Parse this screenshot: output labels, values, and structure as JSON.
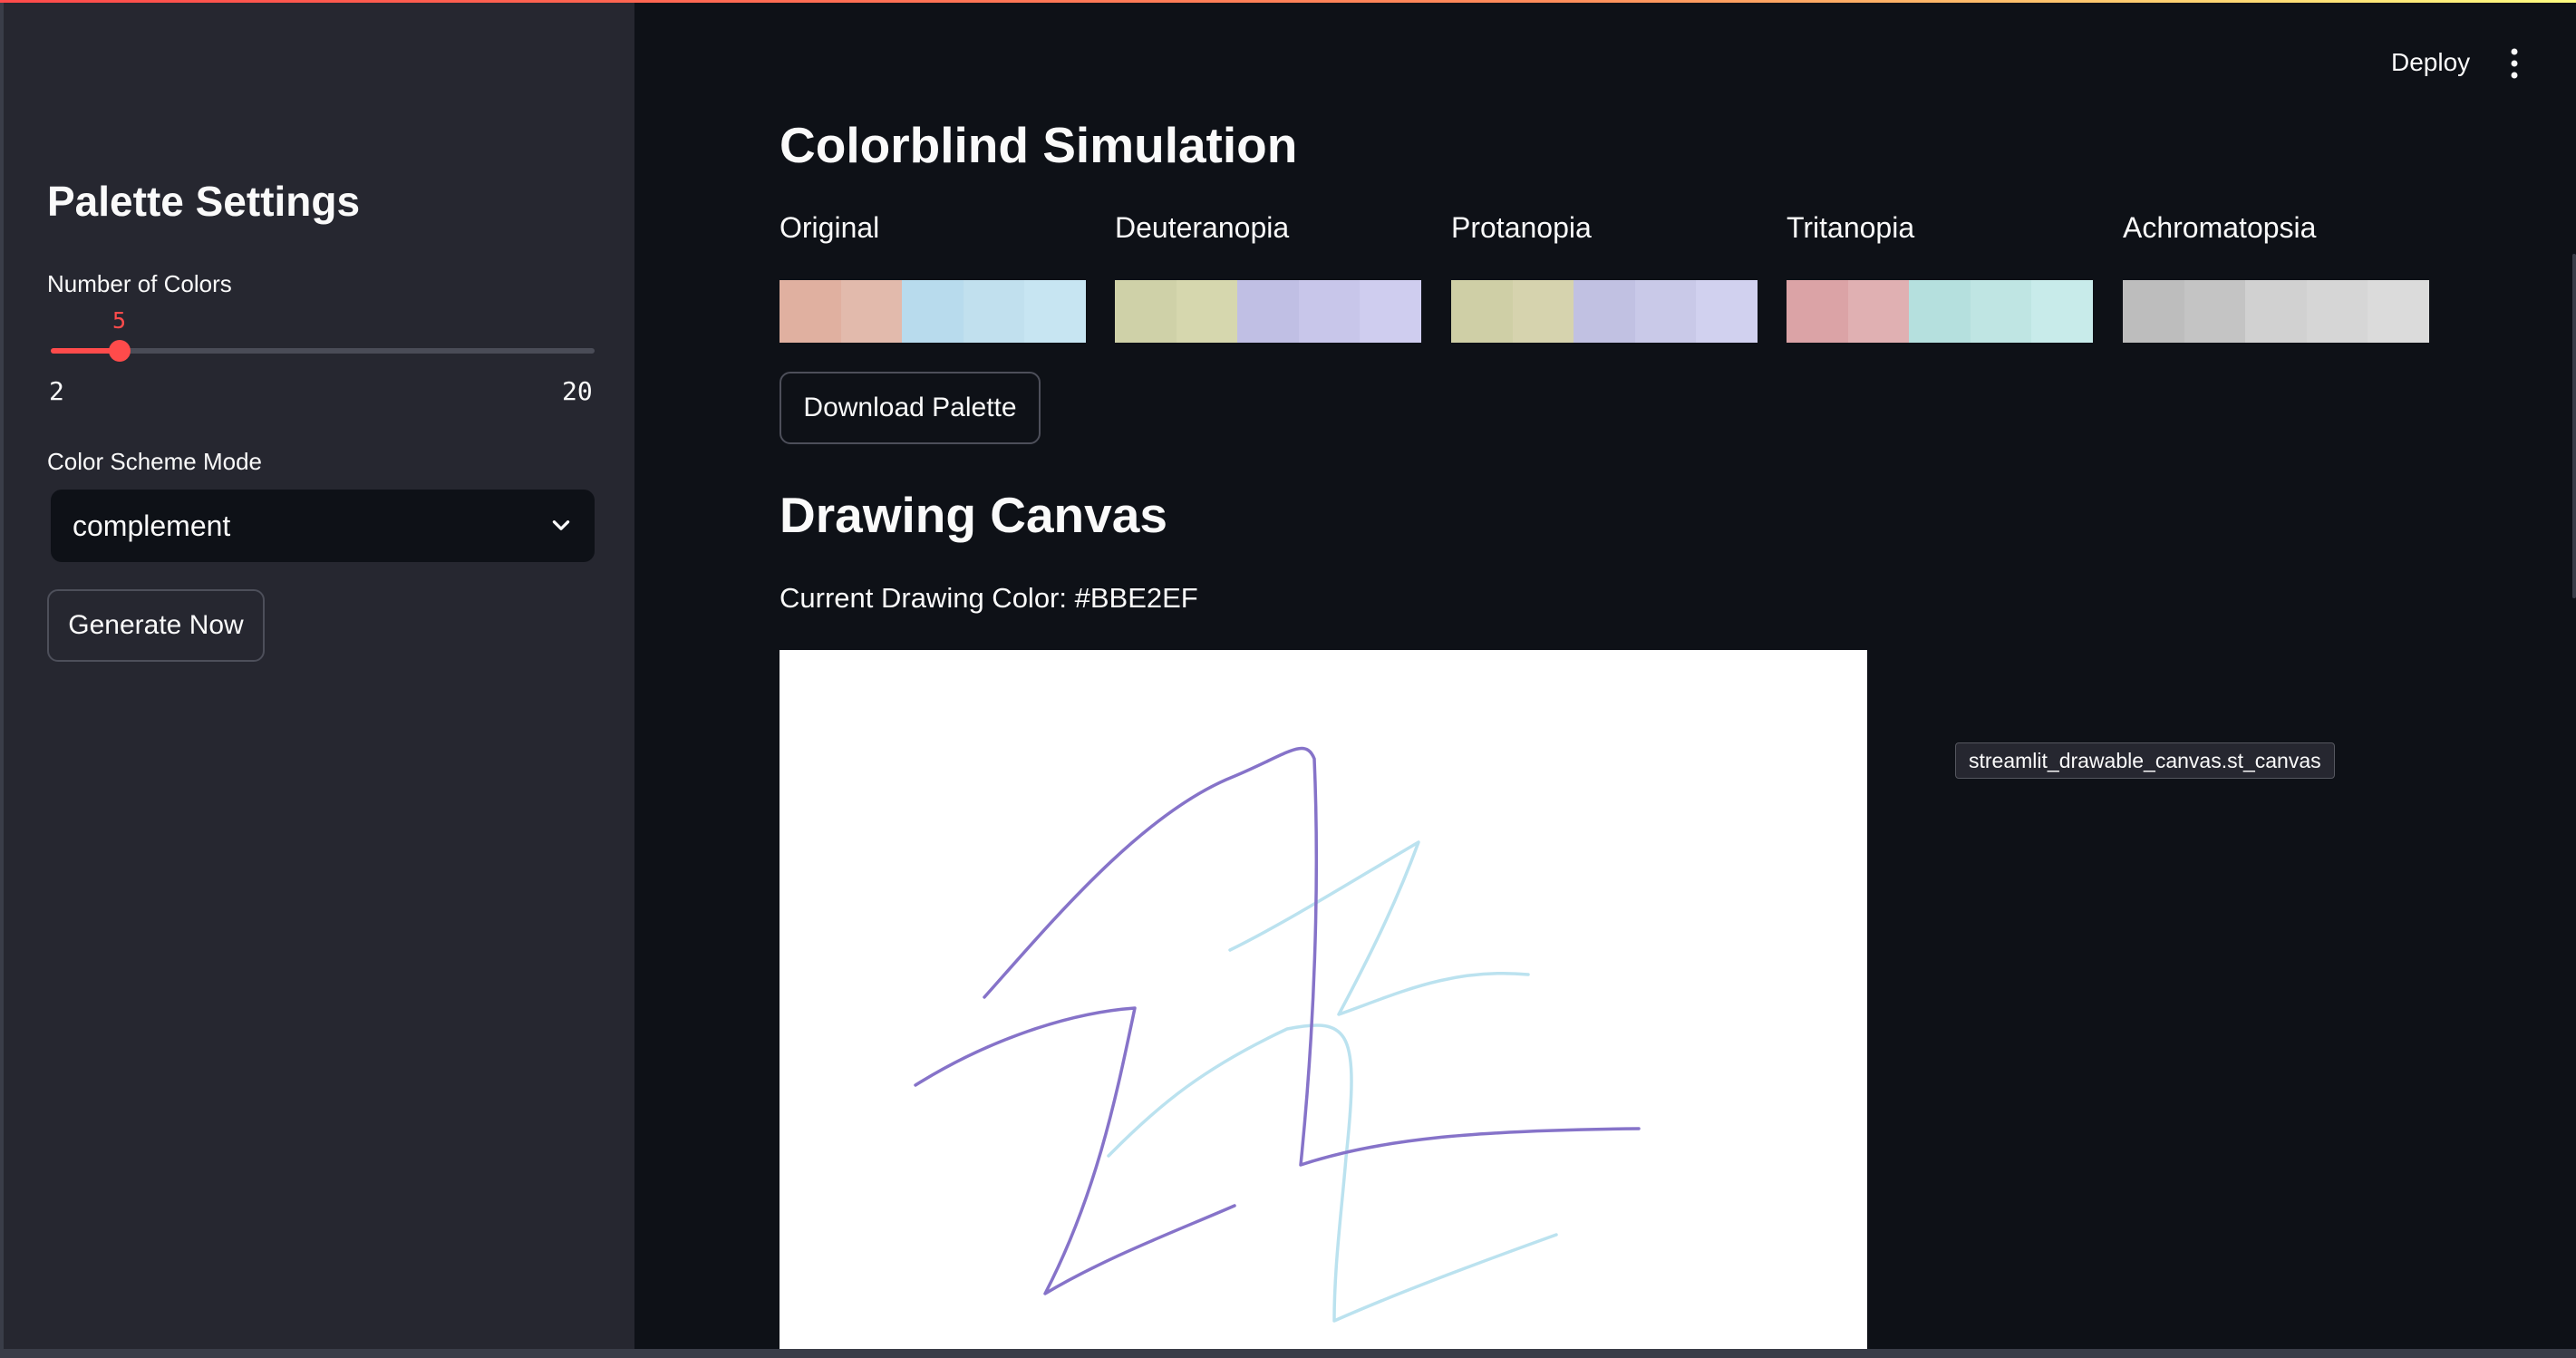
{
  "header": {
    "deploy_label": "Deploy",
    "menu_icon": "kebab-menu-icon"
  },
  "sidebar": {
    "title": "Palette Settings",
    "num_colors": {
      "label": "Number of Colors",
      "value": 5,
      "value_text": "5",
      "min": 2,
      "min_text": "2",
      "max": 20,
      "max_text": "20"
    },
    "scheme": {
      "label": "Color Scheme Mode",
      "value": "complement",
      "icon": "chevron-down-icon"
    },
    "generate_label": "Generate Now"
  },
  "colorblind": {
    "title": "Colorblind Simulation",
    "columns": [
      {
        "label": "Original",
        "swatches": [
          "#e0b0a0",
          "#e2baac",
          "#b8dbed",
          "#c1e0ee",
          "#c7e5f2"
        ]
      },
      {
        "label": "Deuteranopia",
        "swatches": [
          "#cfd1a8",
          "#d6d7ae",
          "#c0bfe4",
          "#c8c6ea",
          "#cfcdef"
        ]
      },
      {
        "label": "Protanopia",
        "swatches": [
          "#cfcfa6",
          "#d6d3ae",
          "#c1c1e2",
          "#c9c9e8",
          "#d1d1ef"
        ]
      },
      {
        "label": "Tritanopia",
        "swatches": [
          "#dba3a6",
          "#e0b0b2",
          "#b5e0de",
          "#bfe5e3",
          "#c8ebea"
        ]
      },
      {
        "label": "Achromatopsia",
        "swatches": [
          "#bdbdbd",
          "#c4c4c4",
          "#d1d1d1",
          "#d6d6d6",
          "#dbdbdb"
        ]
      }
    ],
    "download_label": "Download Palette"
  },
  "drawing": {
    "title": "Drawing Canvas",
    "current_color_label": "Current Drawing Color: #BBE2EF",
    "tooltip": "streamlit_drawable_canvas.st_canvas",
    "stroke_colors": {
      "purple": "#8673c9",
      "blue": "#bbe2ef"
    }
  }
}
